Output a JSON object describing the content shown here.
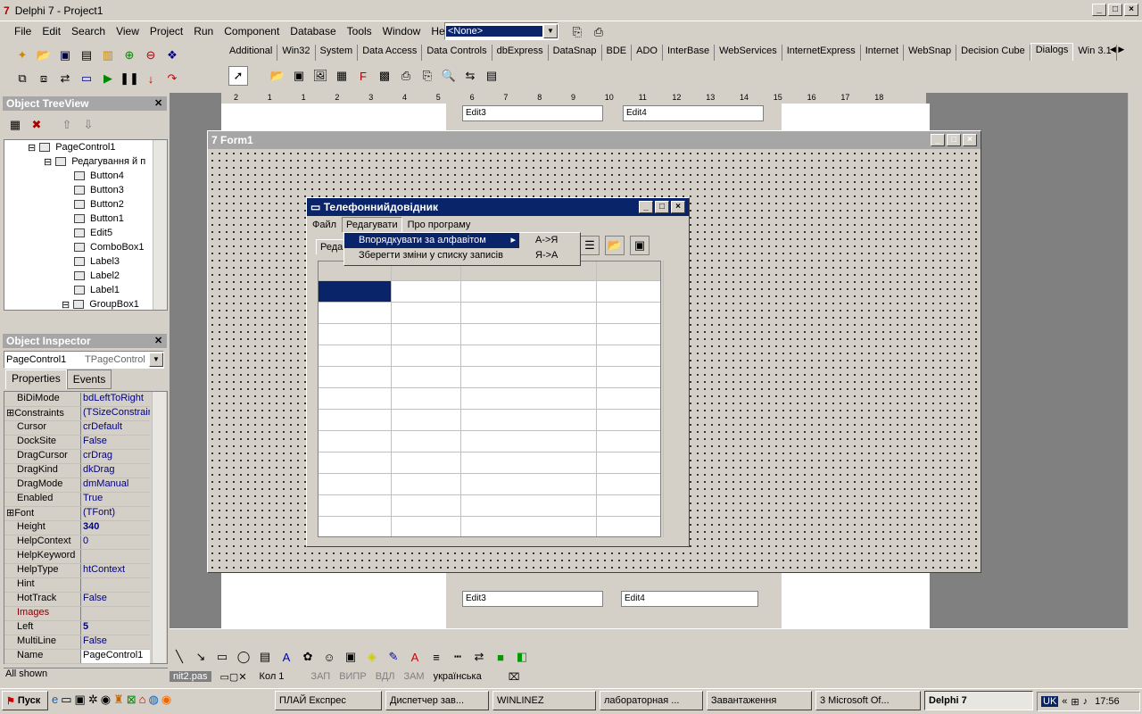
{
  "app": {
    "title": "Delphi 7 - Project1",
    "menu": [
      "File",
      "Edit",
      "Search",
      "View",
      "Project",
      "Run",
      "Component",
      "Database",
      "Tools",
      "Window",
      "Help"
    ],
    "combo_value": "<None>"
  },
  "palette_tabs": [
    "Additional",
    "Win32",
    "System",
    "Data Access",
    "Data Controls",
    "dbExpress",
    "DataSnap",
    "BDE",
    "ADO",
    "InterBase",
    "WebServices",
    "InternetExpress",
    "Internet",
    "WebSnap",
    "Decision Cube",
    "Dialogs",
    "Win 3.1"
  ],
  "treeview": {
    "title": "Object TreeView",
    "items": [
      "PageControl1",
      "Редагування й п",
      "Button4",
      "Button3",
      "Button2",
      "Button1",
      "Edit5",
      "ComboBox1",
      "Label3",
      "Label2",
      "Label1",
      "GroupBox1"
    ]
  },
  "inspector": {
    "title": "Object Inspector",
    "object": "PageControl1",
    "type": "TPageControl",
    "tabs": [
      "Properties",
      "Events"
    ],
    "rows": [
      [
        "BiDiMode",
        "bdLeftToRight"
      ],
      [
        "Constraints",
        "(TSizeConstraint"
      ],
      [
        "Cursor",
        "crDefault"
      ],
      [
        "DockSite",
        "False"
      ],
      [
        "DragCursor",
        "crDrag"
      ],
      [
        "DragKind",
        "dkDrag"
      ],
      [
        "DragMode",
        "dmManual"
      ],
      [
        "Enabled",
        "True"
      ],
      [
        "Font",
        "(TFont)"
      ],
      [
        "Height",
        "340"
      ],
      [
        "HelpContext",
        "0"
      ],
      [
        "HelpKeyword",
        ""
      ],
      [
        "HelpType",
        "htContext"
      ],
      [
        "Hint",
        ""
      ],
      [
        "HotTrack",
        "False"
      ],
      [
        "Images",
        ""
      ],
      [
        "Left",
        "5"
      ],
      [
        "MultiLine",
        "False"
      ],
      [
        "Name",
        "PageControl1"
      ]
    ],
    "status": "All shown"
  },
  "ruler": [
    "2",
    "1",
    "1",
    "2",
    "3",
    "4",
    "5",
    "6",
    "7",
    "8",
    "9",
    "10",
    "11",
    "12",
    "13",
    "14",
    "15",
    "16",
    "17",
    "18"
  ],
  "form1": {
    "title": "Form1"
  },
  "phonebook": {
    "title": "Телефоннийдовідник",
    "menu": [
      "Файл",
      "Редагувати",
      "Про програму"
    ],
    "tab_label": "Реда",
    "submenu": [
      "Впорядкувати за алфавітом",
      "Зберегти зміни у списку записів"
    ],
    "sort_options": [
      "А->Я",
      "Я->А"
    ]
  },
  "designer_edits": [
    "Edit3",
    "Edit4",
    "Edit3",
    "Edit4"
  ],
  "editor_status": {
    "file": "nit2.pas",
    "line": "Кол 1",
    "items": [
      "ЗАП",
      "ВИПР",
      "ВДЛ",
      "ЗАМ",
      "українська"
    ]
  },
  "taskbar": {
    "start": "Пуск",
    "tasks": [
      "ПЛАЙ Експрес",
      "Диспетчер зав...",
      "WINLINEZ",
      "лабораторная ...",
      "Завантаження",
      "3 Microsoft Of...",
      "Delphi 7"
    ],
    "lang": "UK",
    "clock": "17:56"
  }
}
